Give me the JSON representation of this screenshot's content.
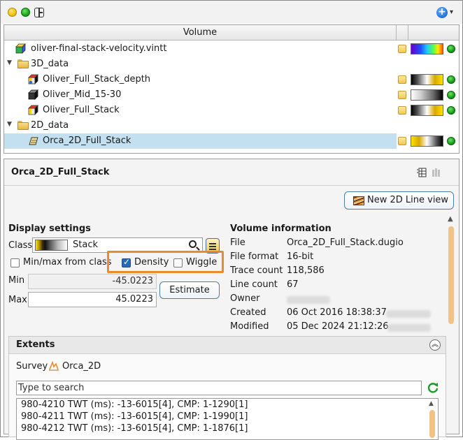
{
  "tree": {
    "header": "Volume",
    "rows": [
      {
        "label": "oliver-final-stack-velocity.vintt",
        "type": "volume",
        "colorbar": "velocity"
      },
      {
        "label": "3D_data",
        "type": "folder"
      },
      {
        "label": "Oliver_Full_Stack_depth",
        "type": "volume",
        "colorbar": "density"
      },
      {
        "label": "Oliver_Mid_15-30",
        "type": "volume",
        "colorbar": "gray"
      },
      {
        "label": "Oliver_Full_Stack",
        "type": "volume",
        "colorbar": "density"
      },
      {
        "label": "2D_data",
        "type": "folder"
      },
      {
        "label": "Orca_2D_Full_Stack",
        "type": "volume2d",
        "colorbar": "density",
        "selected": true
      }
    ]
  },
  "panel": {
    "title": "Orca_2D_Full_Stack",
    "new_view_button": "New 2D Line view"
  },
  "display_settings": {
    "title": "Display settings",
    "class_label": "Class",
    "class_value": "Stack",
    "minmax_label": "Min/max from class",
    "minmax_checked": false,
    "density_label": "Density",
    "density_checked": true,
    "wiggle_label": "Wiggle",
    "wiggle_checked": false,
    "min_label": "Min",
    "min_value": "-45.0223",
    "max_label": "Max",
    "max_value": "45.0223",
    "estimate_button": "Estimate"
  },
  "volume_info": {
    "title": "Volume information",
    "fields": [
      {
        "label": "File",
        "value": "Orca_2D_Full_Stack.dugio"
      },
      {
        "label": "File format",
        "value": "16-bit"
      },
      {
        "label": "Trace count",
        "value": "118,586"
      },
      {
        "label": "Line count",
        "value": "67"
      },
      {
        "label": "Owner",
        "value": ""
      },
      {
        "label": "Created",
        "value": "06 Oct 2016 18:38:37"
      },
      {
        "label": "Modified",
        "value": "05 Dec 2024 21:12:26"
      }
    ]
  },
  "extents": {
    "title": "Extents",
    "survey_label": "Survey",
    "survey_value": "Orca_2D",
    "search_placeholder": "Type to search",
    "lines": [
      "980-4210 TWT (ms): -13-6015[4], CMP: 1-1290[1]",
      "980-4211 TWT (ms): -13-6015[4], CMP: 1-1990[1]",
      "980-4212 TWT (ms): -13-6015[4], CMP: 1-1876[1]"
    ]
  },
  "colors": {
    "accent_highlight": "#e98a2d",
    "selection": "#c2e0f0",
    "status_green": "#16a016"
  }
}
